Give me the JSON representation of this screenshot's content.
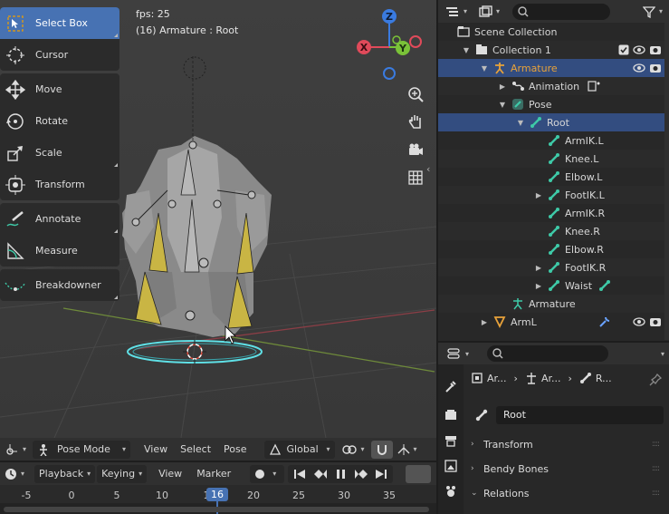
{
  "viewport": {
    "fps_text": "fps: 25",
    "context_text": "(16) Armature : Root",
    "tools": [
      {
        "label": "Select Box",
        "icon": "select-box-icon",
        "active": true
      },
      {
        "label": "Cursor",
        "icon": "cursor-icon"
      },
      {
        "label": "Move",
        "icon": "move-icon"
      },
      {
        "label": "Rotate",
        "icon": "rotate-icon"
      },
      {
        "label": "Scale",
        "icon": "scale-icon"
      },
      {
        "label": "Transform",
        "icon": "transform-icon"
      },
      {
        "label": "Annotate",
        "icon": "annotate-icon"
      },
      {
        "label": "Measure",
        "icon": "measure-icon"
      },
      {
        "label": "Breakdowner",
        "icon": "breakdowner-icon"
      }
    ],
    "gizmo": {
      "z": "Z",
      "y": "Y",
      "x": "X"
    }
  },
  "viewport_header": {
    "mode": "Pose Mode",
    "menus": [
      "View",
      "Select",
      "Pose"
    ],
    "orientation": "Global"
  },
  "timeline_header": {
    "menus": [
      "Playback",
      "Keying",
      "View",
      "Marker"
    ]
  },
  "timeline": {
    "ticks": [
      "-5",
      "0",
      "5",
      "10",
      "1",
      "20",
      "25",
      "30",
      "35"
    ],
    "current_frame": "16"
  },
  "outliner": {
    "rows": [
      {
        "label": "Scene Collection",
        "icon": "scene-collection-icon",
        "depth": 0
      },
      {
        "label": "Collection 1",
        "icon": "collection-icon",
        "depth": 1,
        "expanded": true,
        "checkbox": true,
        "eye": true,
        "camera": true
      },
      {
        "label": "Armature",
        "icon": "armature-object-icon",
        "depth": 2,
        "expanded": true,
        "selected": true,
        "highlight": true,
        "eye": true,
        "camera": true
      },
      {
        "label": "Animation",
        "icon": "animation-icon",
        "depth": 3,
        "collapsed": true,
        "extra": "action-icon"
      },
      {
        "label": "Pose",
        "icon": "pose-icon",
        "depth": 3,
        "expanded": true
      },
      {
        "label": "Root",
        "icon": "bone-icon",
        "depth": 4,
        "expanded": true,
        "selected": true
      },
      {
        "label": "ArmIK.L",
        "icon": "bone-icon",
        "depth": 5
      },
      {
        "label": "Knee.L",
        "icon": "bone-icon",
        "depth": 5
      },
      {
        "label": "Elbow.L",
        "icon": "bone-icon",
        "depth": 5
      },
      {
        "label": "FootIK.L",
        "icon": "bone-icon",
        "depth": 5,
        "collapsed": true
      },
      {
        "label": "ArmIK.R",
        "icon": "bone-icon",
        "depth": 5
      },
      {
        "label": "Knee.R",
        "icon": "bone-icon",
        "depth": 5
      },
      {
        "label": "Elbow.R",
        "icon": "bone-icon",
        "depth": 5
      },
      {
        "label": "FootIK.R",
        "icon": "bone-icon",
        "depth": 5,
        "collapsed": true
      },
      {
        "label": "Waist",
        "icon": "bone-icon",
        "depth": 5,
        "collapsed": true,
        "extra": "bone-icon"
      },
      {
        "label": "Armature",
        "icon": "armature-data-icon",
        "depth": 3
      },
      {
        "label": "ArmL",
        "icon": "mesh-icon",
        "depth": 2,
        "collapsed": true,
        "extra": "wrench-icon",
        "eye": true,
        "camera": true
      }
    ]
  },
  "properties": {
    "breadcrumb": [
      "Ar...",
      "Ar...",
      "R..."
    ],
    "bone_name": "Root",
    "panels": [
      {
        "label": "Transform",
        "expanded": false
      },
      {
        "label": "Bendy Bones",
        "expanded": false
      },
      {
        "label": "Relations",
        "expanded": true
      }
    ]
  },
  "colors": {
    "accent": "#4772b3",
    "selected_row": "#334d80",
    "armature_orange": "#e8a23a",
    "bone_teal": "#3ec9a7",
    "axis_x": "#e04a5a",
    "axis_y": "#7ac238",
    "axis_z": "#3a7be0"
  }
}
